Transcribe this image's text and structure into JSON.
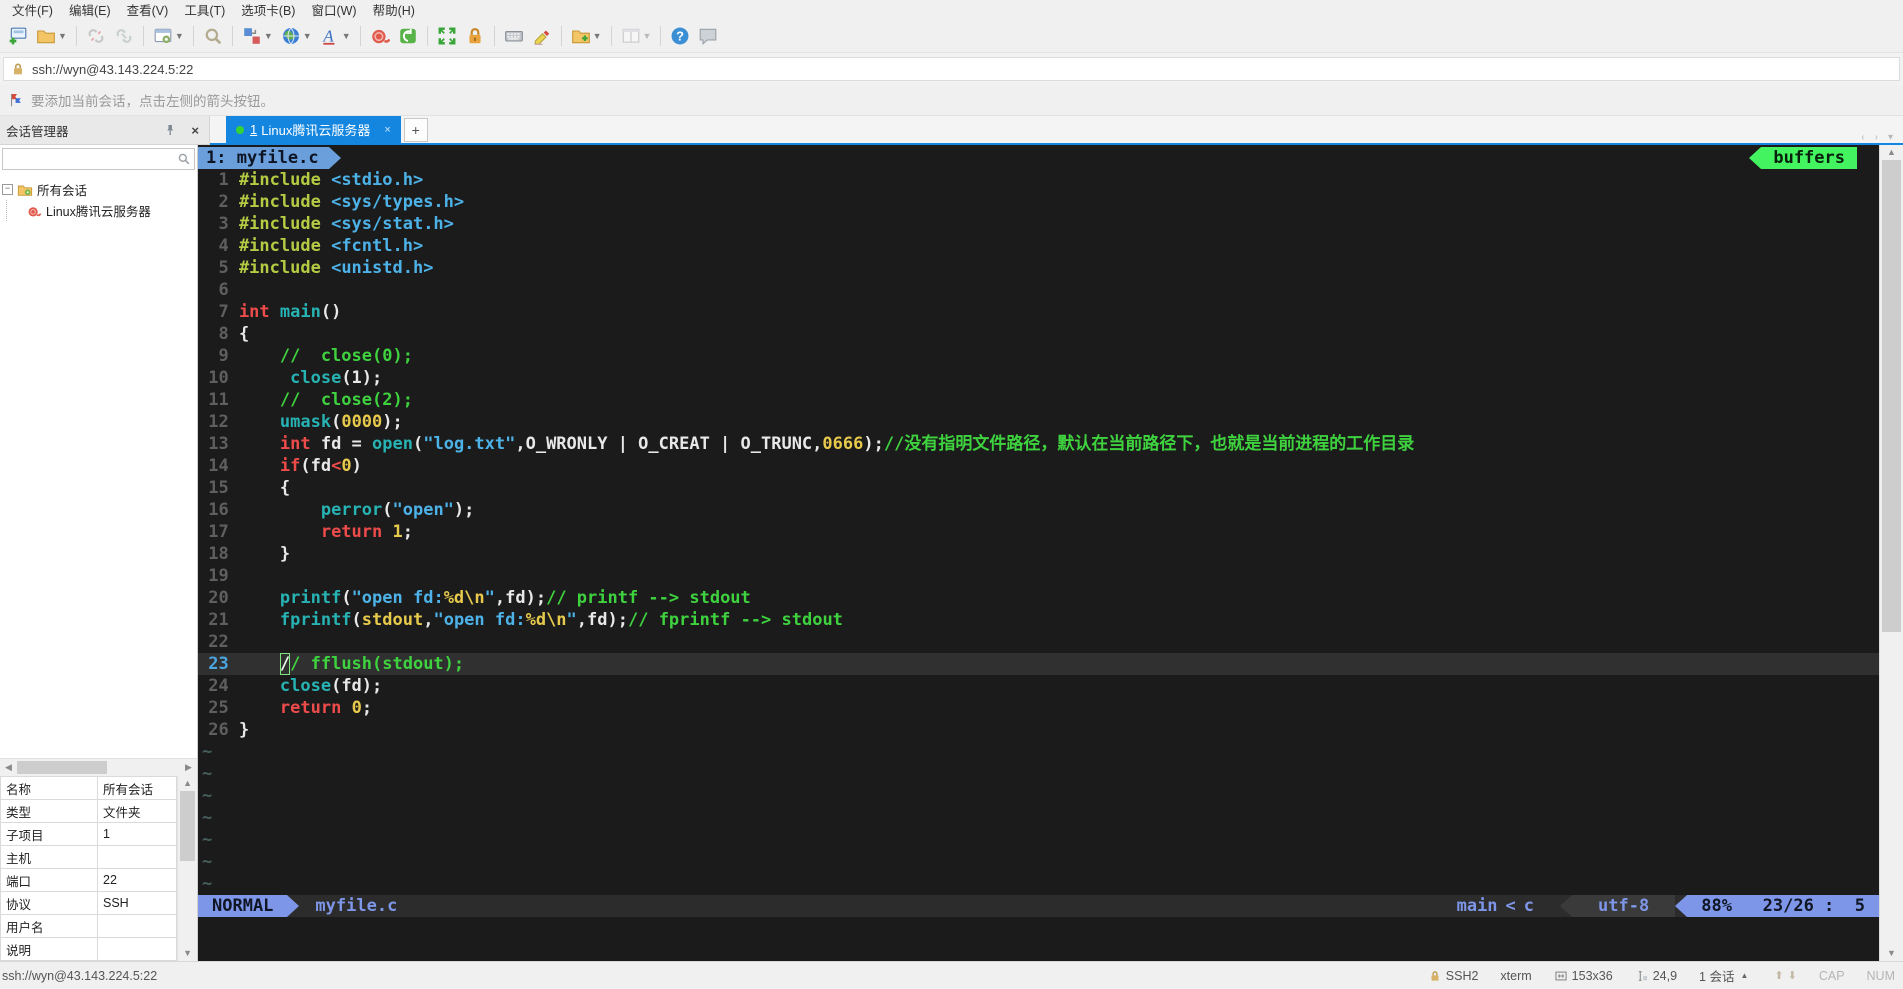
{
  "menu": {
    "items": [
      "文件(F)",
      "编辑(E)",
      "查看(V)",
      "工具(T)",
      "选项卡(B)",
      "窗口(W)",
      "帮助(H)"
    ]
  },
  "toolbar": {
    "buttons": [
      {
        "name": "new-session-icon"
      },
      {
        "name": "open-folder-icon",
        "dropdown": true
      },
      {
        "sep": true
      },
      {
        "name": "disconnect-icon",
        "disabled": true
      },
      {
        "name": "reconnect-icon",
        "disabled": true
      },
      {
        "sep": true
      },
      {
        "name": "session-properties-icon",
        "dropdown": true
      },
      {
        "sep": true
      },
      {
        "name": "find-icon"
      },
      {
        "sep": true
      },
      {
        "name": "arrange-icon",
        "dropdown": true
      },
      {
        "name": "web-icon",
        "dropdown": true
      },
      {
        "name": "font-icon",
        "dropdown": true
      },
      {
        "sep": true
      },
      {
        "name": "snail-icon"
      },
      {
        "name": "package-icon"
      },
      {
        "sep": true
      },
      {
        "name": "fullscreen-icon"
      },
      {
        "name": "lock-icon"
      },
      {
        "sep": true
      },
      {
        "name": "keyboard-icon"
      },
      {
        "name": "highlighter-icon"
      },
      {
        "sep": true
      },
      {
        "name": "new-folder-icon",
        "dropdown": true
      },
      {
        "sep": true
      },
      {
        "name": "split-layout-icon",
        "dropdown": true,
        "disabled": true
      },
      {
        "sep": true
      },
      {
        "name": "help-icon"
      },
      {
        "name": "chat-icon"
      }
    ]
  },
  "address_bar": {
    "value": "ssh://wyn@43.143.224.5:22"
  },
  "notification": {
    "text": "要添加当前会话，点击左侧的箭头按钮。"
  },
  "tabs": {
    "items": [
      {
        "number": "1",
        "label": "Linux腾讯云服务器",
        "close": "×"
      }
    ],
    "new_tab_label": "+"
  },
  "session_panel": {
    "title": "会话管理器",
    "close": "×",
    "tree": [
      {
        "label": "所有会话",
        "type": "folder",
        "expanded": true
      },
      {
        "label": "Linux腾讯云服务器",
        "type": "session"
      }
    ],
    "properties": [
      [
        "名称",
        "所有会话"
      ],
      [
        "类型",
        "文件夹"
      ],
      [
        "子项目",
        "1"
      ],
      [
        "主机",
        ""
      ],
      [
        "端口",
        "22"
      ],
      [
        "协议",
        "SSH"
      ],
      [
        "用户名",
        ""
      ],
      [
        "说明",
        ""
      ]
    ]
  },
  "terminal": {
    "tabline": {
      "buffer_label": "1: myfile.c",
      "right_label": "buffers"
    },
    "current_line": 23,
    "tilde_count": 7,
    "code": [
      {
        "n": 1,
        "segs": [
          [
            "#include",
            "p"
          ],
          [
            " ",
            "w"
          ],
          [
            "<stdio.h>",
            "b"
          ]
        ]
      },
      {
        "n": 2,
        "segs": [
          [
            "#include",
            "p"
          ],
          [
            " ",
            "w"
          ],
          [
            "<sys/types.h>",
            "b"
          ]
        ]
      },
      {
        "n": 3,
        "segs": [
          [
            "#include",
            "p"
          ],
          [
            " ",
            "w"
          ],
          [
            "<sys/stat.h>",
            "b"
          ]
        ]
      },
      {
        "n": 4,
        "segs": [
          [
            "#include",
            "p"
          ],
          [
            " ",
            "w"
          ],
          [
            "<fcntl.h>",
            "b"
          ]
        ]
      },
      {
        "n": 5,
        "segs": [
          [
            "#include",
            "p"
          ],
          [
            " ",
            "w"
          ],
          [
            "<unistd.h>",
            "b"
          ]
        ]
      },
      {
        "n": 6,
        "segs": []
      },
      {
        "n": 7,
        "segs": [
          [
            "int",
            "r"
          ],
          [
            " ",
            "w"
          ],
          [
            "main",
            "t"
          ],
          [
            "()",
            "w"
          ]
        ]
      },
      {
        "n": 8,
        "segs": [
          [
            "{",
            "w"
          ]
        ]
      },
      {
        "n": 9,
        "segs": [
          [
            "    //  close(0);",
            "g"
          ]
        ]
      },
      {
        "n": 10,
        "segs": [
          [
            "     ",
            "w"
          ],
          [
            "close",
            "t"
          ],
          [
            "(1);",
            "w"
          ]
        ]
      },
      {
        "n": 11,
        "segs": [
          [
            "    //  close(2);",
            "g"
          ]
        ]
      },
      {
        "n": 12,
        "segs": [
          [
            "    ",
            "w"
          ],
          [
            "umask",
            "t"
          ],
          [
            "(",
            "w"
          ],
          [
            "0000",
            "y"
          ],
          [
            ");",
            "w"
          ]
        ]
      },
      {
        "n": 13,
        "segs": [
          [
            "    ",
            "w"
          ],
          [
            "int",
            "r"
          ],
          [
            " fd = ",
            "w"
          ],
          [
            "open",
            "t"
          ],
          [
            "(",
            "w"
          ],
          [
            "\"log.txt\"",
            "b"
          ],
          [
            ",O_WRONLY | O_CREAT | O_TRUNC,",
            "w"
          ],
          [
            "0666",
            "y"
          ],
          [
            ");",
            "w"
          ],
          [
            "//没有指明文件路径，默认在当前路径下，也就是当前进程的工作目录",
            "g"
          ]
        ]
      },
      {
        "n": 14,
        "segs": [
          [
            "    ",
            "w"
          ],
          [
            "if",
            "r"
          ],
          [
            "(fd",
            "w"
          ],
          [
            "<",
            "r"
          ],
          [
            "0",
            "y"
          ],
          [
            ")",
            "w"
          ]
        ]
      },
      {
        "n": 15,
        "segs": [
          [
            "    {",
            "w"
          ]
        ]
      },
      {
        "n": 16,
        "segs": [
          [
            "        ",
            "w"
          ],
          [
            "perror",
            "t"
          ],
          [
            "(",
            "w"
          ],
          [
            "\"open\"",
            "b"
          ],
          [
            ");",
            "w"
          ]
        ]
      },
      {
        "n": 17,
        "segs": [
          [
            "        ",
            "w"
          ],
          [
            "return",
            "r"
          ],
          [
            " ",
            "w"
          ],
          [
            "1",
            "y"
          ],
          [
            ";",
            "w"
          ]
        ]
      },
      {
        "n": 18,
        "segs": [
          [
            "    }",
            "w"
          ]
        ]
      },
      {
        "n": 19,
        "segs": []
      },
      {
        "n": 20,
        "segs": [
          [
            "    ",
            "w"
          ],
          [
            "printf",
            "t"
          ],
          [
            "(",
            "w"
          ],
          [
            "\"open fd:",
            "b"
          ],
          [
            "%d\\n",
            "y"
          ],
          [
            "\"",
            "b"
          ],
          [
            ",fd);",
            "w"
          ],
          [
            "// printf --> stdout",
            "g"
          ]
        ]
      },
      {
        "n": 21,
        "segs": [
          [
            "    ",
            "w"
          ],
          [
            "fprintf",
            "t"
          ],
          [
            "(",
            "w"
          ],
          [
            "stdout",
            "y"
          ],
          [
            ",",
            "w"
          ],
          [
            "\"open fd:",
            "b"
          ],
          [
            "%d\\n",
            "y"
          ],
          [
            "\"",
            "b"
          ],
          [
            ",fd);",
            "w"
          ],
          [
            "// fprintf --> stdout",
            "g"
          ]
        ]
      },
      {
        "n": 22,
        "segs": []
      },
      {
        "n": 23,
        "segs": [
          [
            "    ",
            "w"
          ],
          [
            "/",
            "g",
            true
          ],
          [
            "/ fflush(stdout);",
            "g"
          ]
        ]
      },
      {
        "n": 24,
        "segs": [
          [
            "    ",
            "w"
          ],
          [
            "close",
            "t"
          ],
          [
            "(fd);",
            "w"
          ]
        ]
      },
      {
        "n": 25,
        "segs": [
          [
            "    ",
            "w"
          ],
          [
            "return",
            "r"
          ],
          [
            " ",
            "w"
          ],
          [
            "0",
            "y"
          ],
          [
            ";",
            "w"
          ]
        ]
      },
      {
        "n": 26,
        "segs": [
          [
            "}",
            "w"
          ]
        ]
      }
    ],
    "statusline": {
      "mode": "NORMAL",
      "file": "myfile.c",
      "branch": "main",
      "angle": "<",
      "filetype": "c",
      "encoding": "utf-8",
      "position": "88%   23/26 :  5"
    }
  },
  "status_bar": {
    "left": "ssh://wyn@43.143.224.5:22",
    "protocol": "SSH2",
    "term": "xterm",
    "size": "153x36",
    "cursor": "24,9",
    "sessions": "1 会话",
    "cap": "CAP",
    "num": "NUM"
  },
  "colors": {
    "term_bg": "#1b1b1b",
    "white": "#e8e8e8",
    "preproc": "#b5cb44",
    "blue": "#4db2e8",
    "red": "#ee4b4b",
    "teal": "#27b3b3",
    "yellow": "#e7c94c",
    "green": "#3fd23f",
    "line_number": "#5f5f5f",
    "cur_line_bg": "#303030",
    "cur_line_number": "#4aa5e0",
    "tilde": "#46605f",
    "tabline_blue": "#6a9fdb",
    "status_blue": "#7e96e8",
    "buffers_green": "#43f35f",
    "statusline_bg": "#2c2c2c",
    "encoding_bg": "#3a3a3a",
    "active_tab": "#1486e0"
  }
}
